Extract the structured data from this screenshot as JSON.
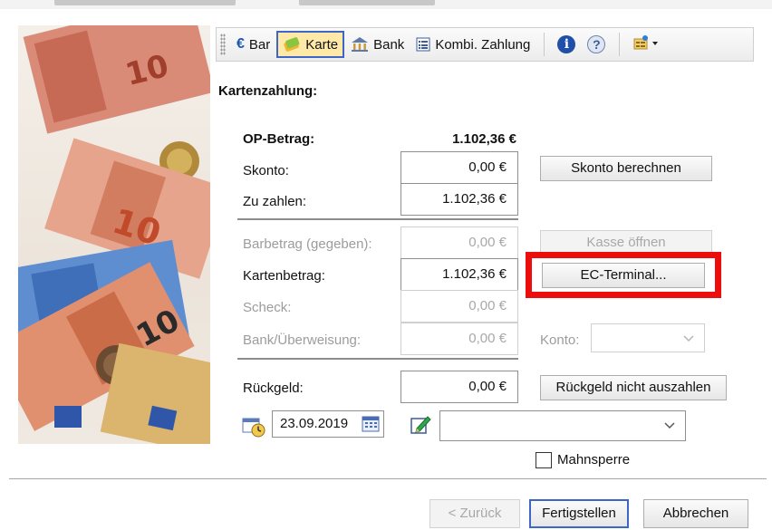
{
  "colors": {
    "highlight": "#ec0d0d",
    "active_tab_bg": "#ffe9a8",
    "active_tab_border": "#3d66c7"
  },
  "toolbar": {
    "tabs": [
      {
        "label": "Bar",
        "icon": "euro-icon"
      },
      {
        "label": "Karte",
        "icon": "card-icon",
        "active": true
      },
      {
        "label": "Bank",
        "icon": "bank-icon"
      },
      {
        "label": "Kombi. Zahlung",
        "icon": "list-icon"
      }
    ],
    "info_icon": "info-icon",
    "help_icon": "help-icon",
    "menu_icon": "dropdown-grid-icon"
  },
  "section_title": "Kartenzahlung:",
  "op": {
    "label": "OP-Betrag:",
    "value": "1.102,36 €"
  },
  "skonto": {
    "label": "Skonto:",
    "value": "0,00 €",
    "button": "Skonto berechnen"
  },
  "zu_zahlen": {
    "label": "Zu zahlen:",
    "value": "1.102,36 €"
  },
  "barbetrag": {
    "label": "Barbetrag (gegeben):",
    "value": "0,00 €",
    "button": "Kasse öffnen"
  },
  "kartenbetrag": {
    "label": "Kartenbetrag:",
    "value": "1.102,36 €",
    "button": "EC-Terminal..."
  },
  "scheck": {
    "label": "Scheck:",
    "value": "0,00 €"
  },
  "bank": {
    "label": "Bank/Überweisung:",
    "value": "0,00 €",
    "konto_label": "Konto:",
    "konto_value": ""
  },
  "rueckgeld": {
    "label": "Rückgeld:",
    "value": "0,00 €",
    "button": "Rückgeld nicht auszahlen"
  },
  "date": {
    "value": "23.09.2019"
  },
  "note": {
    "value": ""
  },
  "mahnsperre": {
    "label": "Mahnsperre",
    "checked": false
  },
  "footer": {
    "back": "< Zurück",
    "finish": "Fertigstellen",
    "cancel": "Abbrechen"
  }
}
